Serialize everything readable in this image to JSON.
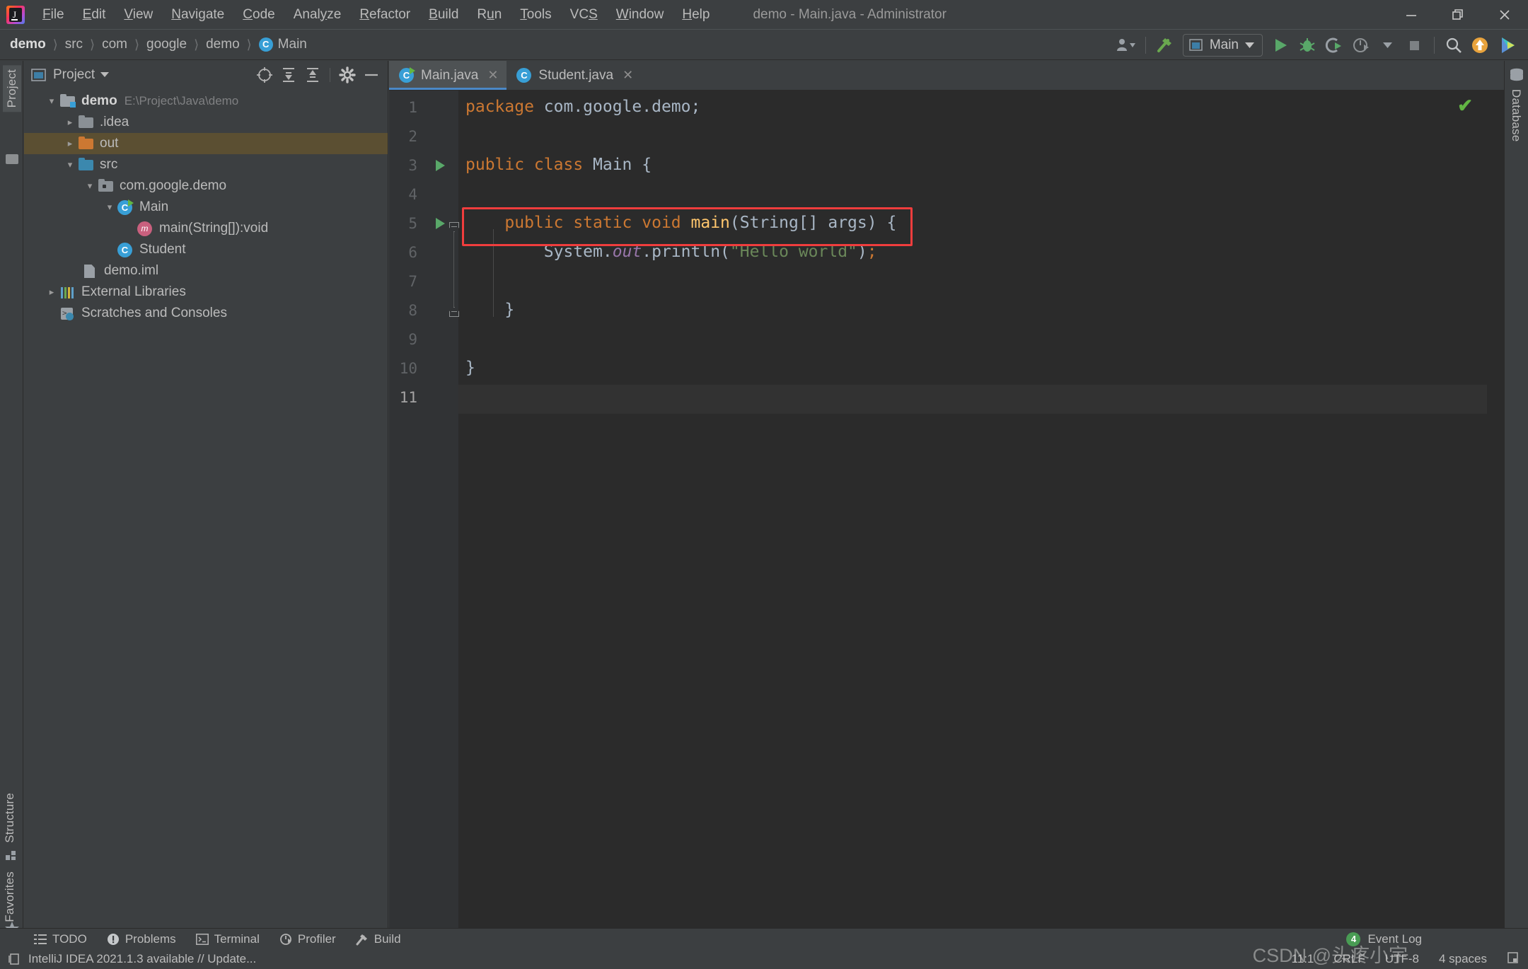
{
  "window": {
    "title": "demo - Main.java - Administrator",
    "controls": [
      "minimize",
      "maximize",
      "close"
    ]
  },
  "menu": {
    "items": [
      {
        "label": "File",
        "mnemonic": "F"
      },
      {
        "label": "Edit",
        "mnemonic": "E"
      },
      {
        "label": "View",
        "mnemonic": "V"
      },
      {
        "label": "Navigate",
        "mnemonic": "N"
      },
      {
        "label": "Code",
        "mnemonic": "C"
      },
      {
        "label": "Analyze",
        "mnemonic": "y"
      },
      {
        "label": "Refactor",
        "mnemonic": "R"
      },
      {
        "label": "Build",
        "mnemonic": "B"
      },
      {
        "label": "Run",
        "mnemonic": "u"
      },
      {
        "label": "Tools",
        "mnemonic": "T"
      },
      {
        "label": "VCS",
        "mnemonic": "S"
      },
      {
        "label": "Window",
        "mnemonic": "W"
      },
      {
        "label": "Help",
        "mnemonic": "H"
      }
    ]
  },
  "breadcrumb": {
    "items": [
      "demo",
      "src",
      "com",
      "google",
      "demo"
    ],
    "last": {
      "label": "Main",
      "icon_letter": "C"
    },
    "separator": "〉"
  },
  "toolbar": {
    "run_config": "Main",
    "icons": [
      "user-avatar-icon",
      "hammer-build-icon",
      "run-config-selector",
      "run-icon",
      "debug-icon",
      "run-with-coverage-icon",
      "profile-icon",
      "stop-icon",
      "search-everywhere-icon",
      "update-project-icon",
      "ide-features-icon"
    ]
  },
  "left_stripe": {
    "top_tab": "Project",
    "bottom_tabs": [
      "Structure",
      "Favorites"
    ]
  },
  "right_stripe": {
    "tabs": [
      "Database"
    ]
  },
  "project_panel": {
    "title": "Project",
    "tools": [
      "locate-icon",
      "expand-all-icon",
      "collapse-all-icon",
      "settings-gear-icon",
      "hide-icon"
    ],
    "tree": [
      {
        "label": "demo",
        "path": "E:\\Project\\Java\\demo",
        "indent": 0,
        "arrow": "down",
        "icon": "project-folder",
        "bold": true,
        "selected": false
      },
      {
        "label": ".idea",
        "path": "",
        "indent": 1,
        "arrow": "right",
        "icon": "folder-grey",
        "bold": false,
        "selected": false
      },
      {
        "label": "out",
        "path": "",
        "indent": 1,
        "arrow": "right",
        "icon": "folder-orange",
        "bold": false,
        "selected": true
      },
      {
        "label": "src",
        "path": "",
        "indent": 1,
        "arrow": "down",
        "icon": "folder-source",
        "bold": false,
        "selected": false
      },
      {
        "label": "com.google.demo",
        "path": "",
        "indent": 2,
        "arrow": "down",
        "icon": "package-icon",
        "bold": false,
        "selected": false
      },
      {
        "label": "Main",
        "path": "",
        "indent": 3,
        "arrow": "down",
        "icon": "class-runnable-icon",
        "bold": false,
        "selected": false
      },
      {
        "label": "main(String[]):void",
        "path": "",
        "indent": 4,
        "arrow": "none",
        "icon": "method-icon",
        "bold": false,
        "selected": false
      },
      {
        "label": "Student",
        "path": "",
        "indent": 3,
        "arrow": "none",
        "icon": "class-icon",
        "bold": false,
        "selected": false
      },
      {
        "label": "demo.iml",
        "path": "",
        "indent": 2,
        "arrow": "none",
        "icon": "iml-file-icon",
        "bold": false,
        "selected": false
      },
      {
        "label": "External Libraries",
        "path": "",
        "indent": 0,
        "arrow": "right",
        "icon": "libraries-icon",
        "bold": false,
        "selected": false
      },
      {
        "label": "Scratches and Consoles",
        "path": "",
        "indent": 0,
        "arrow": "none",
        "icon": "scratches-icon",
        "bold": false,
        "selected": false
      }
    ]
  },
  "editor": {
    "tabs": [
      {
        "label": "Main.java",
        "icon": "class-runnable-icon",
        "active": true
      },
      {
        "label": "Student.java",
        "icon": "class-icon",
        "active": false
      }
    ],
    "inspection_status": "ok-checkmark",
    "line_numbers": [
      "1",
      "2",
      "3",
      "4",
      "5",
      "6",
      "7",
      "8",
      "9",
      "10",
      "11"
    ],
    "caret_line": 11,
    "gutter_run_lines": [
      3,
      5
    ],
    "code_lines": [
      {
        "n": 1,
        "tokens": [
          {
            "t": "package ",
            "c": "k"
          },
          {
            "t": "com.google.demo",
            "c": "pl"
          },
          {
            "t": ";",
            "c": "pl"
          }
        ]
      },
      {
        "n": 2,
        "tokens": []
      },
      {
        "n": 3,
        "tokens": [
          {
            "t": "public class ",
            "c": "k"
          },
          {
            "t": "Main ",
            "c": "pl"
          },
          {
            "t": "{",
            "c": "pl"
          }
        ]
      },
      {
        "n": 4,
        "tokens": []
      },
      {
        "n": 5,
        "tokens": [
          {
            "t": "    ",
            "c": "pl"
          },
          {
            "t": "public static void ",
            "c": "k"
          },
          {
            "t": "main",
            "c": "fn"
          },
          {
            "t": "(String[] args) {",
            "c": "pl"
          }
        ]
      },
      {
        "n": 6,
        "tokens": [
          {
            "t": "        System.",
            "c": "pl"
          },
          {
            "t": "out",
            "c": "fld2"
          },
          {
            "t": ".println(",
            "c": "pl"
          },
          {
            "t": "\"Hello world\"",
            "c": "sd"
          },
          {
            "t": ")",
            "c": "pl"
          },
          {
            "t": ";",
            "c": "se"
          }
        ]
      },
      {
        "n": 7,
        "tokens": []
      },
      {
        "n": 8,
        "tokens": [
          {
            "t": "    }",
            "c": "pl"
          }
        ]
      },
      {
        "n": 9,
        "tokens": []
      },
      {
        "n": 10,
        "tokens": [
          {
            "t": "}",
            "c": "pl"
          }
        ]
      },
      {
        "n": 11,
        "tokens": []
      }
    ],
    "annotation": {
      "type": "red-rectangle",
      "target_line": 5,
      "color": "#f03d3d"
    }
  },
  "bottom_toolbar": {
    "items": [
      {
        "label": "TODO",
        "icon": "todo-list-icon"
      },
      {
        "label": "Problems",
        "icon": "problems-icon"
      },
      {
        "label": "Terminal",
        "icon": "terminal-icon"
      },
      {
        "label": "Profiler",
        "icon": "profiler-icon"
      },
      {
        "label": "Build",
        "icon": "build-hammer-icon"
      }
    ],
    "event_log": {
      "label": "Event Log",
      "count": "4"
    }
  },
  "status_bar": {
    "message": "IntelliJ IDEA 2021.1.3 available // Update...",
    "caret_position": "11:1",
    "line_separator": "CRLF",
    "encoding": "UTF-8",
    "indent": "4 spaces",
    "lock_icon": "read-write-lock-icon"
  },
  "watermark": "CSDN @头疼小宇",
  "colors": {
    "chrome": "#3c3f41",
    "editor_bg": "#2b2b2b",
    "gutter_bg": "#313335",
    "accent_blue": "#4a88c7",
    "selection_tree": "#5b4f32",
    "annotation_red": "#f03d3d",
    "keyword_orange": "#cc7832",
    "string_green": "#6a8759",
    "method_yellow": "#ffc66d",
    "field_purple": "#9876aa",
    "plain_text": "#a9b7c6",
    "run_green": "#59a869"
  }
}
